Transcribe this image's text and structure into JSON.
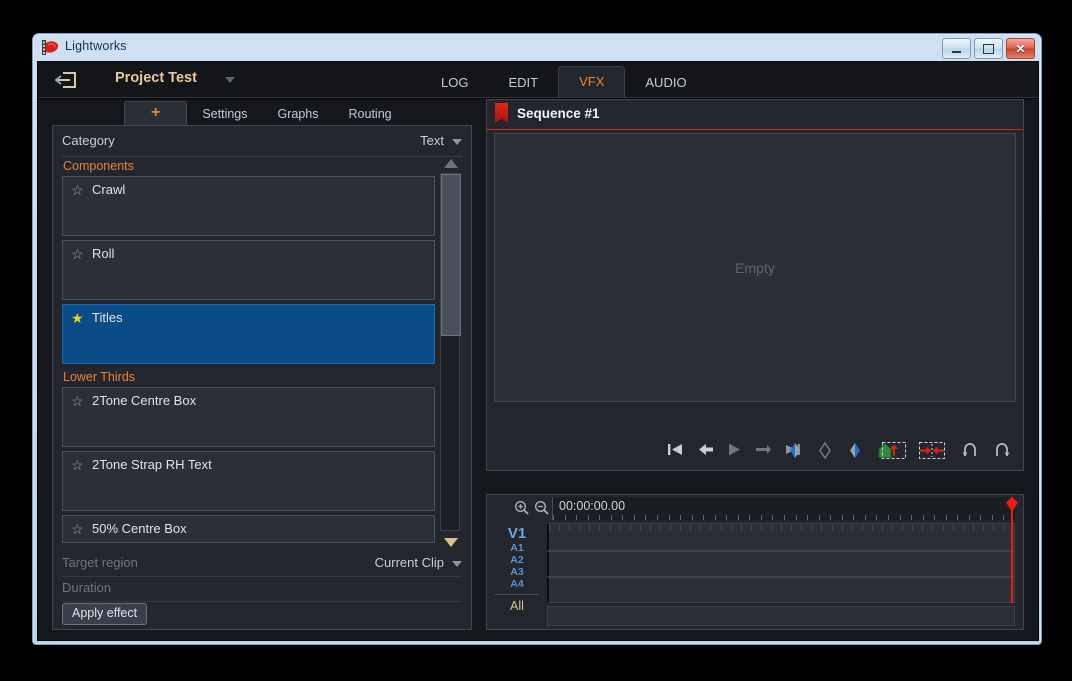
{
  "window": {
    "title": "Lightworks",
    "icon": "lightworks-logo-icon",
    "buttons": {
      "minimize": "minimize-icon",
      "maximize": "maximize-icon",
      "close": "close-icon"
    }
  },
  "topbar": {
    "exit_icon": "exit-project-icon",
    "project_name": "Project Test",
    "project_caret": "chevron-down-icon",
    "tabs": [
      {
        "label": "LOG",
        "active": false
      },
      {
        "label": "EDIT",
        "active": false
      },
      {
        "label": "VFX",
        "active": true
      },
      {
        "label": "AUDIO",
        "active": false
      }
    ]
  },
  "left_panel": {
    "tabs": [
      {
        "label": "+",
        "active": true
      },
      {
        "label": "Settings",
        "active": false
      },
      {
        "label": "Graphs",
        "active": false
      },
      {
        "label": "Routing",
        "active": false
      }
    ],
    "category": {
      "label": "Category",
      "value": "Text",
      "caret": "chevron-down-icon"
    },
    "groups": [
      {
        "name": "Components",
        "items": [
          {
            "name": "Crawl",
            "starred": false,
            "selected": false
          },
          {
            "name": "Roll",
            "starred": false,
            "selected": false
          },
          {
            "name": "Titles",
            "starred": true,
            "selected": true
          }
        ]
      },
      {
        "name": "Lower Thirds",
        "items": [
          {
            "name": "2Tone Centre Box",
            "starred": false,
            "selected": false
          },
          {
            "name": "2Tone Strap RH Text",
            "starred": false,
            "selected": false
          },
          {
            "name": "50% Centre Box",
            "starred": false,
            "selected": false
          }
        ]
      }
    ],
    "scrollbar": {
      "up": "scroll-up-arrow-icon",
      "down": "scroll-down-arrow-icon"
    },
    "target_region": {
      "label": "Target region",
      "value": "Current Clip",
      "caret": "chevron-down-icon"
    },
    "duration": {
      "label": "Duration",
      "value": ""
    },
    "apply_button": "Apply effect"
  },
  "viewer": {
    "flag_icon": "red-bookmark-flag-icon",
    "title": "Sequence #1",
    "empty_text": "Empty",
    "transport": {
      "group1": [
        "skip-to-start-icon",
        "step-back-icon",
        "play-icon",
        "step-forward-icon",
        "skip-to-end-icon"
      ],
      "group2": [
        "mark-in-icon",
        "mark-clear-icon",
        "mark-out-icon",
        "mark-home-icon"
      ],
      "group3": [
        "insert-edit-icon",
        "replace-edit-icon"
      ],
      "group4": [
        "undo-icon",
        "redo-icon"
      ]
    }
  },
  "timeline": {
    "zoom_in_icon": "zoom-in-icon",
    "zoom_out_icon": "zoom-out-icon",
    "timecode": "00:00:00.00",
    "tracks": {
      "video": "V1",
      "audio": [
        "A1",
        "A2",
        "A3",
        "A4"
      ],
      "all": "All"
    },
    "playhead": "playhead-marker"
  },
  "colors": {
    "accent_orange": "#e8833a",
    "selection_blue": "#0b4c86",
    "star_yellow": "#f5d016",
    "playhead_red": "#e61e10",
    "panel_bg": "#23262c",
    "app_bg": "#15171c"
  }
}
